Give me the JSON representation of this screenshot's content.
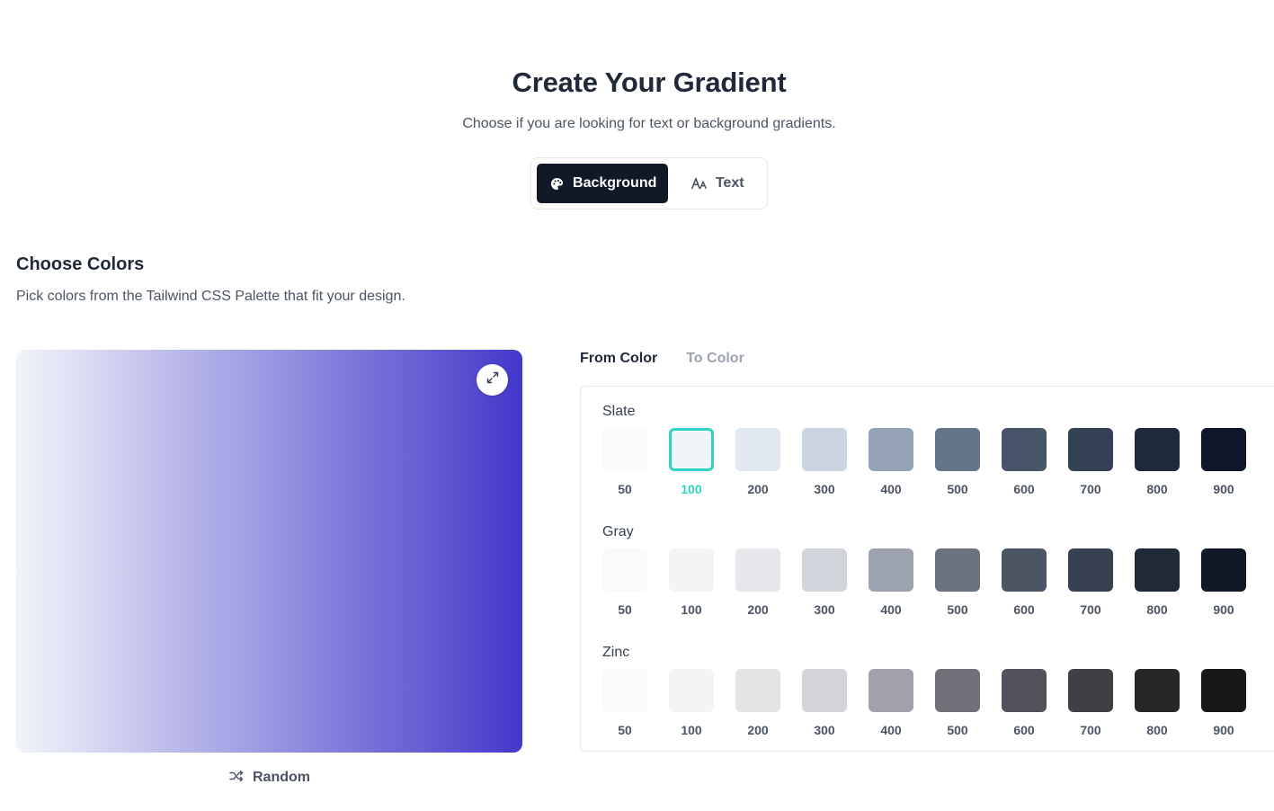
{
  "header": {
    "title": "Create Your Gradient",
    "subtitle": "Choose if you are looking for text or background gradients."
  },
  "mode_toggle": {
    "selected": "Background",
    "options": [
      {
        "label": "Background",
        "icon": "palette-icon"
      },
      {
        "label": "Text",
        "icon": "font-size-icon"
      }
    ]
  },
  "colors_section": {
    "title": "Choose Colors",
    "description": "Pick colors from the Tailwind CSS Palette that fit your design."
  },
  "preview": {
    "gradient_from": "#f1f5f9",
    "gradient_to": "#4338ca",
    "direction": "to right",
    "expand_icon": "expand-arrows-icon"
  },
  "random_button": {
    "label": "Random",
    "icon": "shuffle-icon"
  },
  "color_tabs": {
    "selected": "From Color",
    "tabs": [
      "From Color",
      "To Color"
    ]
  },
  "palette": {
    "selected": {
      "group": "Slate",
      "shade": "100"
    },
    "accent_color": "#2dd4bf",
    "groups": [
      {
        "name": "Slate",
        "shades": [
          {
            "label": "50",
            "color": "#f8fafc"
          },
          {
            "label": "100",
            "color": "#f1f5f9"
          },
          {
            "label": "200",
            "color": "#e2e8f0"
          },
          {
            "label": "300",
            "color": "#cbd5e1"
          },
          {
            "label": "400",
            "color": "#94a3b8"
          },
          {
            "label": "500",
            "color": "#64748b"
          },
          {
            "label": "600",
            "color": "#475569"
          },
          {
            "label": "700",
            "color": "#334155"
          },
          {
            "label": "800",
            "color": "#1e293b"
          },
          {
            "label": "900",
            "color": "#0f172a"
          }
        ]
      },
      {
        "name": "Gray",
        "shades": [
          {
            "label": "50",
            "color": "#f9fafb"
          },
          {
            "label": "100",
            "color": "#f3f4f6"
          },
          {
            "label": "200",
            "color": "#e5e7eb"
          },
          {
            "label": "300",
            "color": "#d1d5db"
          },
          {
            "label": "400",
            "color": "#9ca3af"
          },
          {
            "label": "500",
            "color": "#6b7280"
          },
          {
            "label": "600",
            "color": "#4b5563"
          },
          {
            "label": "700",
            "color": "#374151"
          },
          {
            "label": "800",
            "color": "#1f2937"
          },
          {
            "label": "900",
            "color": "#111827"
          }
        ]
      },
      {
        "name": "Zinc",
        "shades": [
          {
            "label": "50",
            "color": "#fafafa"
          },
          {
            "label": "100",
            "color": "#f4f4f5"
          },
          {
            "label": "200",
            "color": "#e4e4e7"
          },
          {
            "label": "300",
            "color": "#d4d4d8"
          },
          {
            "label": "400",
            "color": "#a1a1aa"
          },
          {
            "label": "500",
            "color": "#71717a"
          },
          {
            "label": "600",
            "color": "#52525b"
          },
          {
            "label": "700",
            "color": "#3f3f46"
          },
          {
            "label": "800",
            "color": "#27272a"
          },
          {
            "label": "900",
            "color": "#18181b"
          }
        ]
      }
    ]
  }
}
